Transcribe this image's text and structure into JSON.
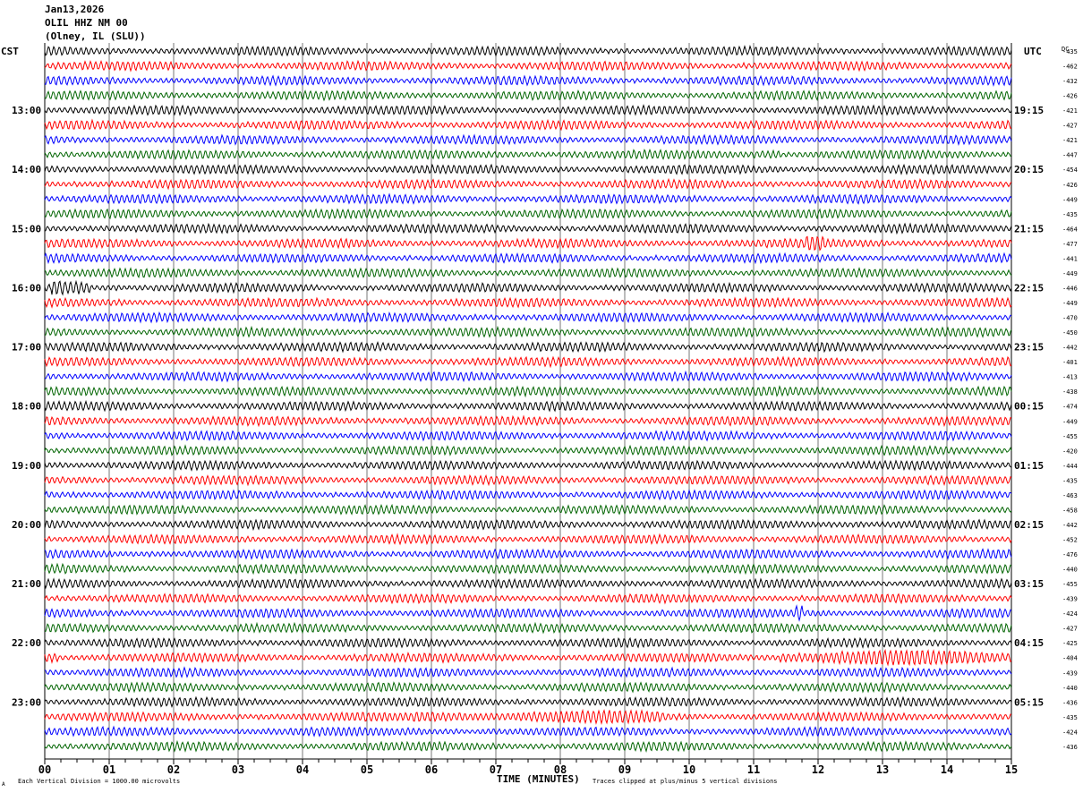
{
  "header": {
    "date": "Jan13,2026",
    "station": "OLIL HHZ NM 00",
    "location": "(Olney, IL (SLU))"
  },
  "chart_data": {
    "type": "line",
    "title": "",
    "left_axis_label": "CST",
    "right_axis_label": "UTC",
    "dc_label": "DC",
    "xlabel": "TIME (MINUTES)",
    "xlim": [
      0,
      15
    ],
    "x_ticks": [
      "00",
      "01",
      "02",
      "03",
      "04",
      "05",
      "06",
      "07",
      "08",
      "09",
      "10",
      "11",
      "12",
      "13",
      "14",
      "15"
    ],
    "grid": "vertical lines every minute",
    "trace_colors": [
      "#000000",
      "#ff0000",
      "#0000ff",
      "#006400"
    ],
    "left_hour_labels": [
      {
        "row": 4,
        "label": "13:00"
      },
      {
        "row": 8,
        "label": "14:00"
      },
      {
        "row": 12,
        "label": "15:00"
      },
      {
        "row": 16,
        "label": "16:00"
      },
      {
        "row": 20,
        "label": "17:00"
      },
      {
        "row": 24,
        "label": "18:00"
      },
      {
        "row": 28,
        "label": "19:00"
      },
      {
        "row": 32,
        "label": "20:00"
      },
      {
        "row": 36,
        "label": "21:00"
      },
      {
        "row": 40,
        "label": "22:00"
      },
      {
        "row": 44,
        "label": "23:00"
      }
    ],
    "right_hour_labels": [
      {
        "row": 4,
        "label": "19:15"
      },
      {
        "row": 8,
        "label": "20:15"
      },
      {
        "row": 12,
        "label": "21:15"
      },
      {
        "row": 16,
        "label": "22:15"
      },
      {
        "row": 20,
        "label": "23:15"
      },
      {
        "row": 24,
        "label": "00:15"
      },
      {
        "row": 28,
        "label": "01:15"
      },
      {
        "row": 32,
        "label": "02:15"
      },
      {
        "row": 36,
        "label": "03:15"
      },
      {
        "row": 40,
        "label": "04:15"
      },
      {
        "row": 44,
        "label": "05:15"
      }
    ],
    "dc_offsets": [
      -435,
      -462,
      -432,
      -426,
      -421,
      -427,
      -421,
      -447,
      -454,
      -426,
      -449,
      -435,
      -464,
      -477,
      -441,
      -449,
      -446,
      -449,
      -470,
      -450,
      -442,
      -401,
      -413,
      -438,
      -474,
      -449,
      -455,
      -420,
      -444,
      -435,
      -463,
      -458,
      -442,
      -452,
      -476,
      -440,
      -455,
      -439,
      -424,
      -427,
      -425,
      -404,
      -439,
      -440,
      -436,
      -435,
      -424,
      -436
    ],
    "events": [
      {
        "row": 16,
        "start_min": 0.1,
        "end_min": 0.7,
        "amp": 2.2
      },
      {
        "row": 41,
        "start_min": 11.4,
        "end_min": 15,
        "amp": 1.8
      },
      {
        "row": 45,
        "start_min": 5.7,
        "end_min": 9.6,
        "amp": 1.5
      },
      {
        "row": 38,
        "start_min": 11.65,
        "end_min": 11.75,
        "amp": 3.5
      },
      {
        "row": 13,
        "start_min": 11.8,
        "end_min": 12.1,
        "amp": 1.8
      },
      {
        "row": 7,
        "start_min": 11.0,
        "end_min": 11.4,
        "amp": 1.6
      },
      {
        "row": 41,
        "start_min": 0.0,
        "end_min": 0.2,
        "amp": 1.8
      }
    ]
  },
  "footer": {
    "scale_note": "Each Vertical Division = 1000.00 microvolts",
    "clip_note": "Traces clipped at plus/minus 5 vertical divisions",
    "corner_mark": "A"
  }
}
